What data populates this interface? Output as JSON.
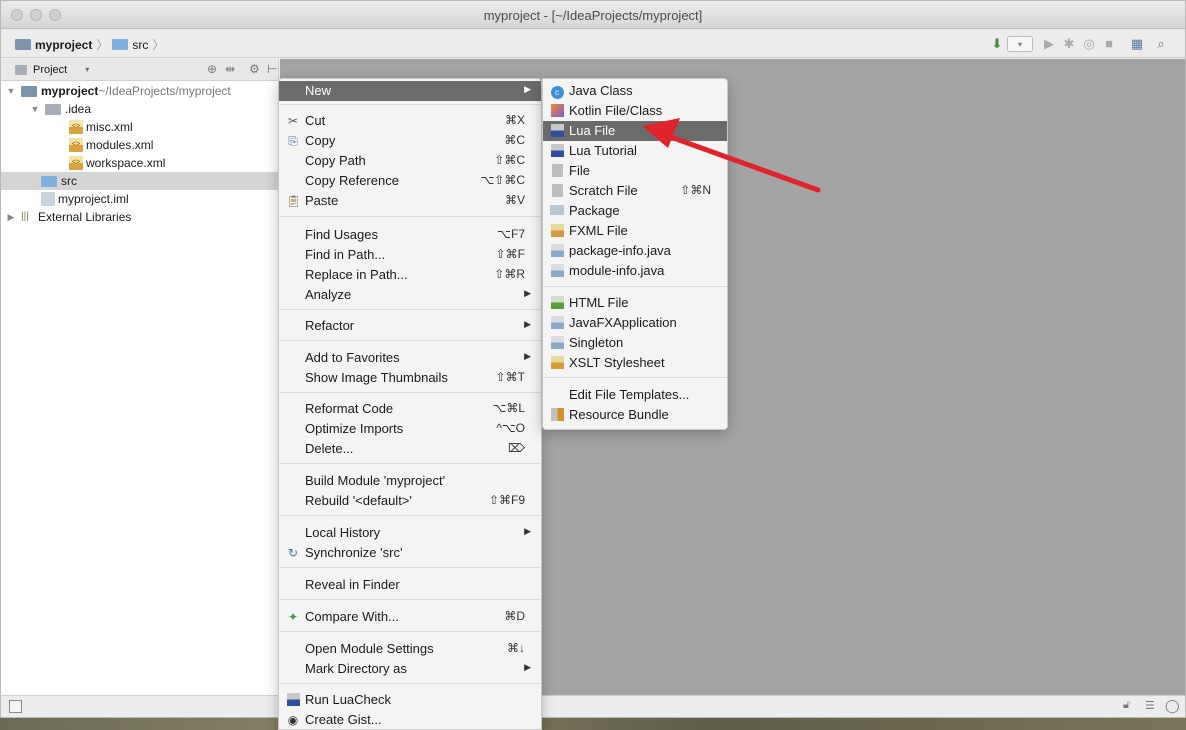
{
  "window": {
    "title": "myproject - [~/IdeaProjects/myproject]"
  },
  "navbar": {
    "crumbs": [
      "myproject",
      "src"
    ]
  },
  "panel": {
    "header_label": "Project"
  },
  "tree": [
    {
      "label": "myproject",
      "suffix": " ~/IdeaProjects/myproject",
      "level": 0,
      "expanded": true,
      "bold": true
    },
    {
      "label": ".idea",
      "level": 1,
      "expanded": true
    },
    {
      "label": "misc.xml",
      "level": 2
    },
    {
      "label": "modules.xml",
      "level": 2
    },
    {
      "label": "workspace.xml",
      "level": 2
    },
    {
      "label": "src",
      "level": 1,
      "selected": true
    },
    {
      "label": "myproject.iml",
      "level": 1
    },
    {
      "label": "External Libraries",
      "level": 0,
      "expanded": false
    }
  ],
  "context_menu": {
    "new": "New",
    "cut": "Cut",
    "cut_sc": "⌘X",
    "copy": "Copy",
    "copy_sc": "⌘C",
    "copy_path": "Copy Path",
    "copy_path_sc": "⇧⌘C",
    "copy_reference": "Copy Reference",
    "copy_reference_sc": "⌥⇧⌘C",
    "paste": "Paste",
    "paste_sc": "⌘V",
    "find_usages": "Find Usages",
    "find_usages_sc": "⌥F7",
    "find_in_path": "Find in Path...",
    "find_in_path_sc": "⇧⌘F",
    "replace_in_path": "Replace in Path...",
    "replace_in_path_sc": "⇧⌘R",
    "analyze": "Analyze",
    "refactor": "Refactor",
    "add_to_favorites": "Add to Favorites",
    "show_image_thumbnails": "Show Image Thumbnails",
    "show_image_thumbnails_sc": "⇧⌘T",
    "reformat_code": "Reformat Code",
    "reformat_code_sc": "⌥⌘L",
    "optimize_imports": "Optimize Imports",
    "optimize_imports_sc": "^⌥O",
    "delete": "Delete...",
    "delete_sc": "⌦",
    "build_module": "Build Module 'myproject'",
    "rebuild": "Rebuild '<default>'",
    "rebuild_sc": "⇧⌘F9",
    "local_history": "Local History",
    "synchronize": "Synchronize 'src'",
    "reveal_in_finder": "Reveal in Finder",
    "compare_with": "Compare With...",
    "compare_with_sc": "⌘D",
    "open_module_settings": "Open Module Settings",
    "open_module_settings_sc": "⌘↓",
    "mark_directory_as": "Mark Directory as",
    "run_luacheck": "Run LuaCheck",
    "create_gist": "Create Gist..."
  },
  "submenu": {
    "java_class": "Java Class",
    "kotlin_file_class": "Kotlin File/Class",
    "lua_file": "Lua File",
    "lua_tutorial": "Lua Tutorial",
    "file": "File",
    "scratch_file": "Scratch File",
    "scratch_file_sc": "⇧⌘N",
    "package": "Package",
    "fxml_file": "FXML File",
    "package_info": "package-info.java",
    "module_info": "module-info.java",
    "html_file": "HTML File",
    "javafx_application": "JavaFXApplication",
    "singleton": "Singleton",
    "xslt_stylesheet": "XSLT Stylesheet",
    "edit_file_templates": "Edit File Templates...",
    "resource_bundle": "Resource Bundle"
  },
  "colors": {
    "highlight": "#6b6b6b",
    "annotation_arrow": "#e0242a"
  }
}
